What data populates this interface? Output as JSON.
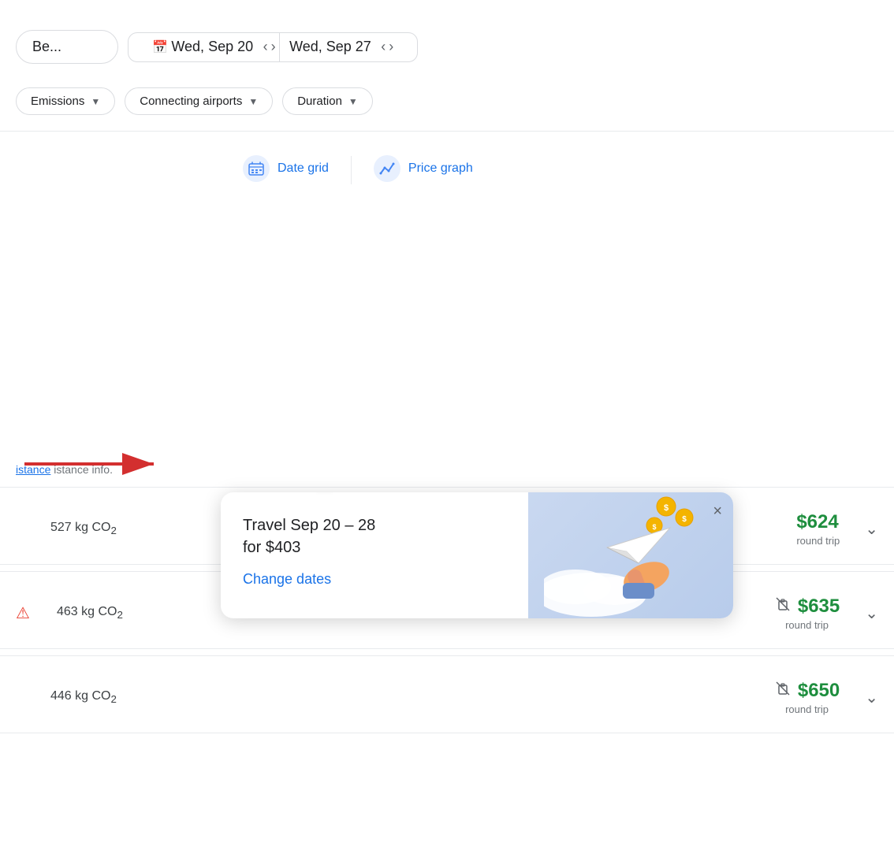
{
  "header": {
    "left_label": "Be...",
    "date1": "Wed, Sep 20",
    "date2": "Wed, Sep 27",
    "cal_icon": "📅"
  },
  "filters": {
    "emissions_label": "Emissions",
    "connecting_airports_label": "Connecting airports",
    "duration_label": "Duration"
  },
  "tabs": {
    "date_grid_label": "Date grid",
    "price_graph_label": "Price graph"
  },
  "tooltip": {
    "title": "Travel Sep 20 – 28\nfor $403",
    "cta": "Change dates",
    "close_icon": "×"
  },
  "assist": {
    "text": "istance info."
  },
  "flights": [
    {
      "co2": "527 kg CO",
      "co2_sub": "2",
      "price": "$624",
      "round_trip": "round trip",
      "has_luggage_icon": false,
      "has_warning": false
    },
    {
      "co2": "463 kg CO",
      "co2_sub": "2",
      "price": "$635",
      "round_trip": "round trip",
      "has_luggage_icon": true,
      "has_warning": true
    },
    {
      "co2": "446 kg CO",
      "co2_sub": "2",
      "price": "$650",
      "round_trip": "round trip",
      "has_luggage_icon": true,
      "has_warning": false
    }
  ],
  "colors": {
    "blue": "#1a73e8",
    "green": "#1e8e3e",
    "red": "#ea4335",
    "gray": "#5f6368"
  }
}
